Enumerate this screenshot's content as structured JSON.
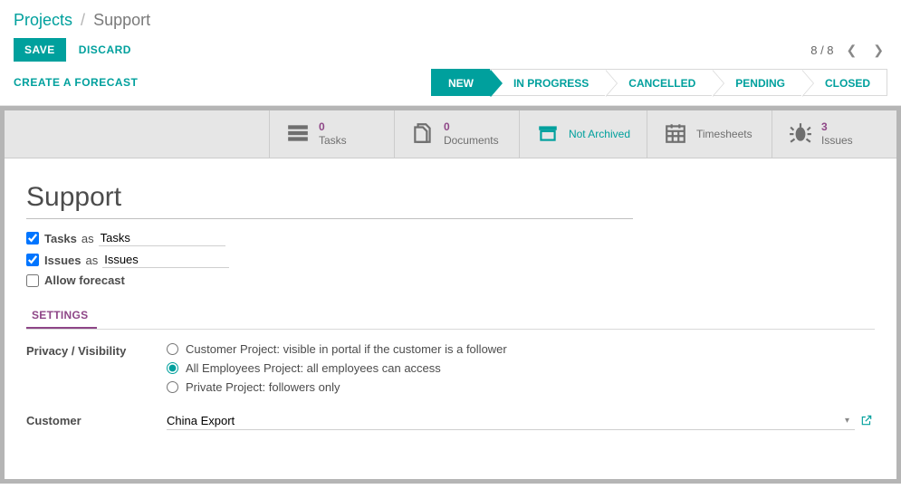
{
  "breadcrumb": {
    "root": "Projects",
    "current": "Support"
  },
  "toolbar": {
    "save": "SAVE",
    "discard": "DISCARD"
  },
  "pager": {
    "text": "8 / 8"
  },
  "secondary": {
    "forecast": "CREATE A FORECAST"
  },
  "status": {
    "steps": [
      {
        "label": "NEW",
        "active": true
      },
      {
        "label": "IN PROGRESS",
        "active": false
      },
      {
        "label": "CANCELLED",
        "active": false
      },
      {
        "label": "PENDING",
        "active": false
      },
      {
        "label": "CLOSED",
        "active": false
      }
    ]
  },
  "stats": {
    "tasks": {
      "count": "0",
      "label": "Tasks"
    },
    "documents": {
      "count": "0",
      "label": "Documents"
    },
    "archived": {
      "label": "Not Archived"
    },
    "timesheets": {
      "label": "Timesheets"
    },
    "issues": {
      "count": "3",
      "label": "Issues"
    }
  },
  "form": {
    "title": "Support",
    "tasks_label": "Tasks",
    "tasks_as": "as",
    "tasks_alias": "Tasks",
    "issues_label": "Issues",
    "issues_as": "as",
    "issues_alias": "Issues",
    "allow_forecast_label": "Allow forecast",
    "settings_tab": "SETTINGS",
    "privacy_label": "Privacy / Visibility",
    "visibility": {
      "portal": "Customer Project: visible in portal if the customer is a follower",
      "employees": "All Employees Project: all employees can access",
      "followers": "Private Project: followers only"
    },
    "customer_label": "Customer",
    "customer_value": "China Export"
  }
}
